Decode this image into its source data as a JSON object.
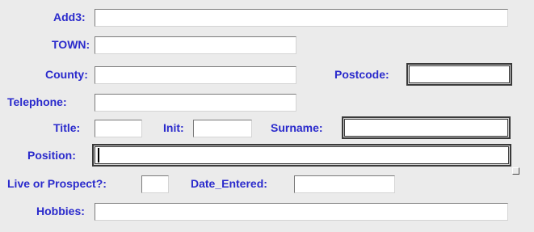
{
  "form": {
    "add3": {
      "label": "Add3:",
      "value": ""
    },
    "town": {
      "label": "TOWN:",
      "value": ""
    },
    "county": {
      "label": "County:",
      "value": ""
    },
    "postcode": {
      "label": "Postcode:",
      "value": ""
    },
    "telephone": {
      "label": "Telephone:",
      "value": ""
    },
    "title": {
      "label": "Title:",
      "value": ""
    },
    "init": {
      "label": "Init:",
      "value": ""
    },
    "surname": {
      "label": "Surname:",
      "value": ""
    },
    "position": {
      "label": "Position:",
      "value": ""
    },
    "live_or_prospect": {
      "label": "Live or Prospect?:",
      "value": ""
    },
    "date_entered": {
      "label": "Date_Entered:",
      "value": ""
    },
    "hobbies": {
      "label": "Hobbies:",
      "value": ""
    }
  },
  "colors": {
    "label": "#2a2acc",
    "background": "#ebebeb",
    "field": "#ffffff"
  }
}
